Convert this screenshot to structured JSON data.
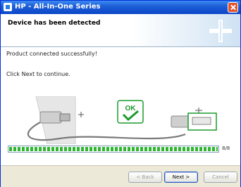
{
  "window": {
    "title": "HP - All-In-One Series"
  },
  "header": {
    "title": "Device has been detected"
  },
  "content": {
    "message": "Product connected successfully!",
    "instruction": "Click Next to continue.",
    "ok_badge": "OK",
    "progress": {
      "fraction": 1.0,
      "label": "8/8"
    }
  },
  "buttons": {
    "back": "< Back",
    "next": "Next >",
    "cancel": "Cancel"
  },
  "icons": [
    "app-icon",
    "close-icon",
    "usb-plug-icon",
    "usb-port-icon",
    "ok-check-icon",
    "hp-plus-logo"
  ],
  "colors": {
    "titlebar": "#0a46c8",
    "progress": "#2fb62f",
    "ok_green": "#1a9b2a"
  }
}
